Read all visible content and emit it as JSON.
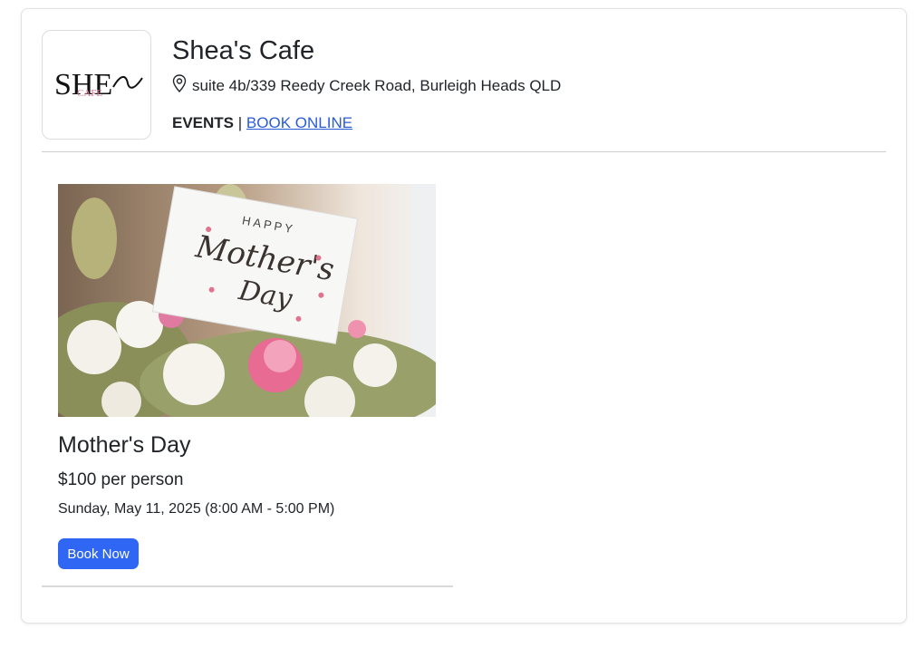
{
  "venue": {
    "name": "Shea's Cafe",
    "address": "suite 4b/339 Reedy Creek Road, Burleigh Heads QLD",
    "logo_text_main": "SHE",
    "logo_text_sub": "CAFE"
  },
  "nav": {
    "events_label": "EVENTS",
    "separator": "|",
    "book_online_label": "BOOK ONLINE"
  },
  "event": {
    "image_text_top": "HAPPY",
    "image_text_script1": "Mother's",
    "image_text_script2": "Day",
    "title": "Mother's Day",
    "price": "$100 per person",
    "date": "Sunday, May 11, 2025 (8:00 AM - 5:00 PM)",
    "book_button_label": "Book Now"
  },
  "colors": {
    "link": "#2a5bd7",
    "button": "#2f66f4",
    "logo_accent": "#d9728f"
  }
}
